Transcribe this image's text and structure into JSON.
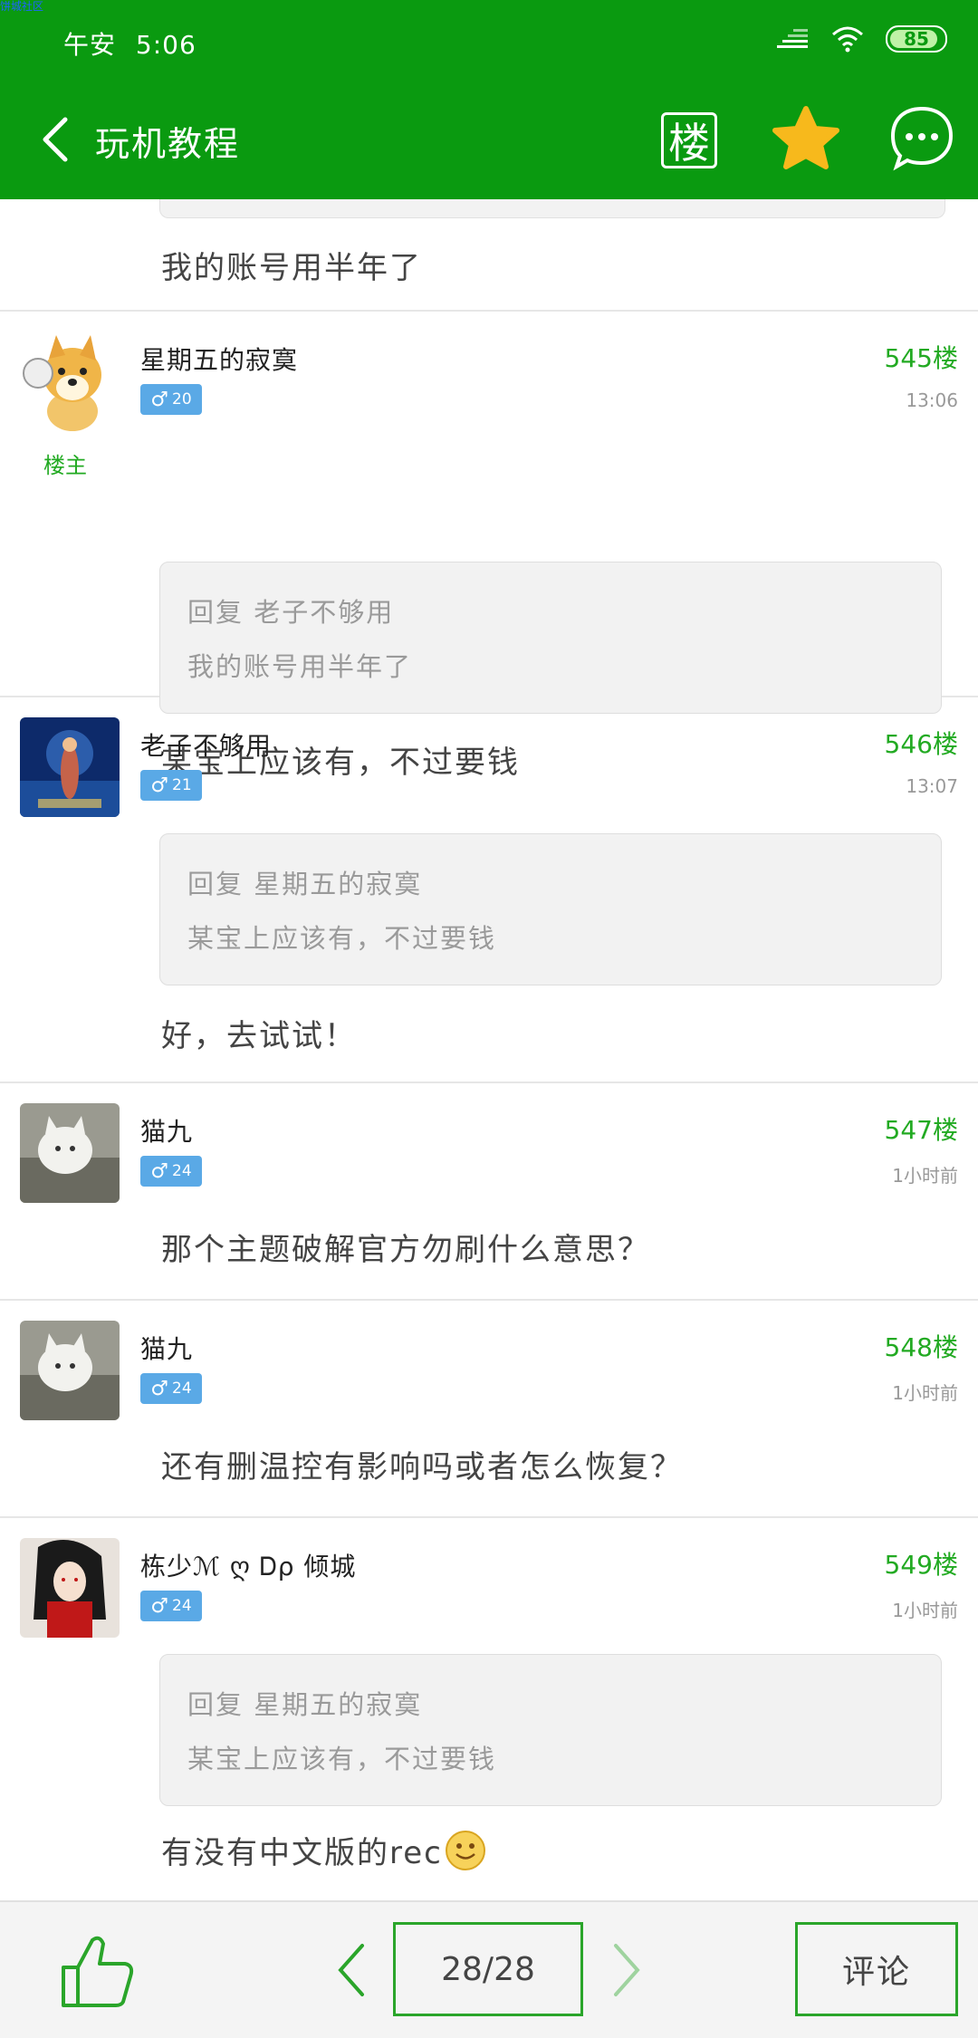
{
  "corner_label": "饼城社区",
  "status_bar": {
    "greeting": "午安",
    "time": "5:06",
    "battery": "85"
  },
  "nav": {
    "title": "玩机教程",
    "floor_button": "楼"
  },
  "prev_tail": {
    "text": "我的账号用半年了"
  },
  "posts": [
    {
      "user": "星期五的寂寞",
      "level": "20",
      "floor": "545楼",
      "time": "13:06",
      "owner_label": "楼主",
      "quote_user": "回复 老子不够用",
      "quote_text": "我的账号用半年了",
      "body": "某宝上应该有，不过要钱"
    },
    {
      "user": "老子不够用",
      "level": "21",
      "floor": "546楼",
      "time": "13:07",
      "quote_user": "回复 星期五的寂寞",
      "quote_text": "某宝上应该有，不过要钱",
      "body": "好，去试试！"
    },
    {
      "user": "猫九",
      "level": "24",
      "floor": "547楼",
      "time": "1小时前",
      "body": "那个主题破解官方勿刷什么意思？"
    },
    {
      "user": "猫九",
      "level": "24",
      "floor": "548楼",
      "time": "1小时前",
      "body": "还有删温控有影响吗或者怎么恢复？"
    },
    {
      "user": "栋少ℳ ღ Ꭰρ 倾城",
      "level": "24",
      "floor": "549楼",
      "time": "1小时前",
      "quote_user": "回复 星期五的寂寞",
      "quote_text": "某宝上应该有，不过要钱",
      "body": "有没有中文版的rec"
    }
  ],
  "gender_symbol": "♂",
  "bottom": {
    "page": "28/28",
    "comment": "评论"
  },
  "colors": {
    "brand_green": "#0a9a10",
    "floor_green": "#22aa22",
    "badge_blue": "#5aa9e6"
  }
}
